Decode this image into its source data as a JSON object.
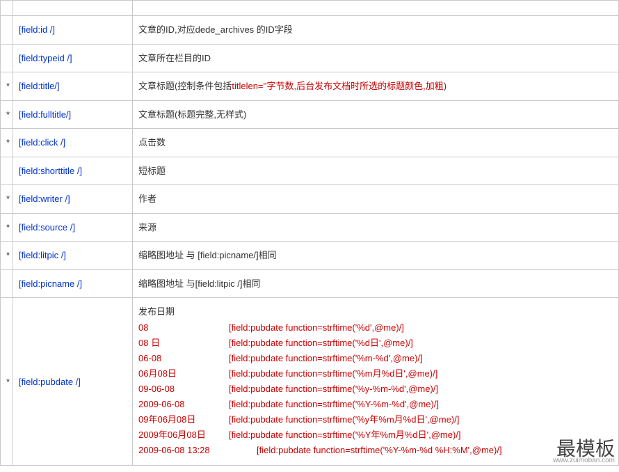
{
  "asterisk": "*",
  "rows": [
    {
      "ast": "",
      "field": "",
      "desc_a": "",
      "desc_b": ""
    },
    {
      "ast": "",
      "field": "[field:id /]",
      "desc_a": "文章的ID,对应dede_archives 的ID字段",
      "desc_b": ""
    },
    {
      "ast": "",
      "field": "[field:typeid /]",
      "desc_a": "文章所在栏目的ID",
      "desc_b": ""
    },
    {
      "ast": "*",
      "field": "[field:title/]",
      "desc_a": "文章标题(控制条件包括",
      "desc_b": "titlelen=''字节数,后台发布文档时所选的标题颜色,加粗",
      "desc_c": ")"
    },
    {
      "ast": "*",
      "field": "[field:fulltitle/]",
      "desc_a": "文章标题(标题完整,无样式)",
      "desc_b": ""
    },
    {
      "ast": "*",
      "field": "[field:click /]",
      "desc_a": "点击数",
      "desc_b": ""
    },
    {
      "ast": "",
      "field": "[field:shorttitle /]",
      "desc_a": "短标题",
      "desc_b": ""
    },
    {
      "ast": "*",
      "field": "[field:writer /]",
      "desc_a": "作者",
      "desc_b": ""
    },
    {
      "ast": "*",
      "field": "[field:source /]",
      "desc_a": "来源",
      "desc_b": ""
    },
    {
      "ast": "*",
      "field": "[field:litpic /]",
      "desc_a": "缩略图地址 与 [field:picname/]相同",
      "desc_b": ""
    },
    {
      "ast": "",
      "field": "[field:picname /]",
      "desc_a": "缩略图地址 与[field:litpic /]相同",
      "desc_b": ""
    }
  ],
  "pubdate": {
    "ast": "*",
    "field": "[field:pubdate /]",
    "title": "发布日期",
    "lines": [
      {
        "key": "08",
        "val": "[field:pubdate function=strftime('%d',@me)/]"
      },
      {
        "key": "08 日",
        "val": "[field:pubdate function=strftime('%d日',@me)/]"
      },
      {
        "key": "06-08",
        "val": "[field:pubdate function=strftime('%m-%d',@me)/]"
      },
      {
        "key": "06月08日",
        "val": "[field:pubdate function=strftime('%m月%d日',@me)/]"
      },
      {
        "key": "09-06-08",
        "val": "[field:pubdate function=strftime('%y-%m-%d',@me)/]"
      },
      {
        "key": "2009-06-08",
        "val": "[field:pubdate function=strftime('%Y-%m-%d',@me)/]"
      },
      {
        "key": "09年06月08日",
        "val": "[field:pubdate function=strftime('%y年%m月%d日',@me)/]"
      },
      {
        "key": "2009年06月08日",
        "val": "[field:pubdate function=strftime('%Y年%m月%d日',@me)/]"
      },
      {
        "key": "2009-06-08  13:28",
        "val": "[field:pubdate function=strftime('%Y-%m-%d %H:%M',@me)/]"
      }
    ]
  },
  "watermark": "最模板",
  "watermark_sub": "www.zuimoban.com"
}
